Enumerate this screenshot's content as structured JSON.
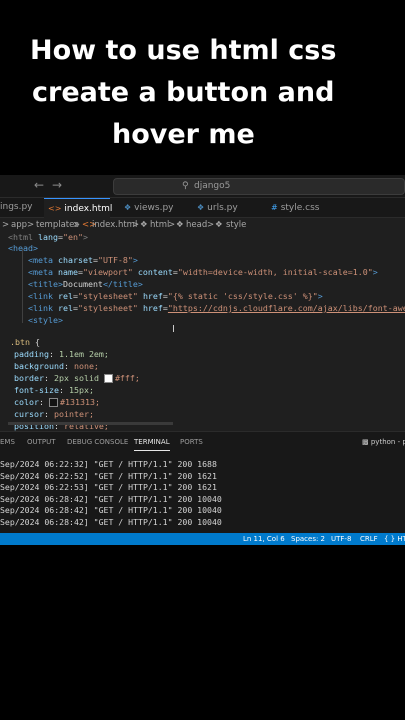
{
  "caption": {
    "line1": "How to use html css",
    "line2": "create a button and",
    "line3": "hover me"
  },
  "titlebar": {
    "back_icon": "arrow-left-icon",
    "forward_icon": "arrow-right-icon",
    "search_text": "django5",
    "search_icon": "search-icon"
  },
  "tabs": [
    {
      "label": "ings.py",
      "icon": "python-file-icon",
      "active": false
    },
    {
      "label": "index.html",
      "icon": "html-file-icon",
      "active": true
    },
    {
      "label": "views.py",
      "icon": "python-file-icon",
      "active": false
    },
    {
      "label": "urls.py",
      "icon": "python-file-icon",
      "active": false
    },
    {
      "label": "style.css",
      "icon": "css-file-icon",
      "active": false
    }
  ],
  "breadcrumb": {
    "parts": [
      "app",
      "templates",
      "index.html",
      "html",
      "head",
      "style"
    ],
    "separator": ">"
  },
  "code": {
    "l1": {
      "open": "<html ",
      "attr": "lang",
      "eq": "=",
      "val": "\"en\"",
      "close": ">"
    },
    "l2": "<head>",
    "l3": {
      "open": "<meta ",
      "attr": "charset",
      "val": "\"UTF-8\"",
      "close": ">"
    },
    "l4": {
      "open": "<meta ",
      "attr1": "name",
      "val1": "\"viewport\"",
      "attr2": "content",
      "val2": "\"width=device-width, initial-scale=1.0\"",
      "close": ">"
    },
    "l5": {
      "open": "<title>",
      "text": "Document",
      "close": "</title>"
    },
    "l6": {
      "open": "<link ",
      "attr1": "rel",
      "val1": "\"stylesheet\"",
      "attr2": "href",
      "val2": "\"{% static 'css/style.css' %}\"",
      "close": ">"
    },
    "l7": {
      "open": "<link ",
      "attr1": "rel",
      "val1": "\"stylesheet\"",
      "attr2": "href",
      "val2": "\"https://cdnjs.cloudflare.com/ajax/libs/font-awesome"
    },
    "l8": "<style>",
    "l9": {
      "selector": ".btn",
      "brace": " {"
    },
    "props": [
      {
        "name": "padding",
        "value": "1.1em 2em;"
      },
      {
        "name": "background",
        "value": "none;"
      },
      {
        "name": "border",
        "value": "2px solid ",
        "swatch": "#ffffff",
        "value2": "#fff;"
      },
      {
        "name": "font-size",
        "value": "15px;"
      },
      {
        "name": "color",
        "value": "",
        "swatch": "#131313",
        "value2": "#131313;"
      },
      {
        "name": "cursor",
        "value": "pointer;"
      },
      {
        "name": "position",
        "value": "relative;"
      }
    ]
  },
  "panel": {
    "tabs": [
      "EMS",
      "OUTPUT",
      "DEBUG CONSOLE",
      "TERMINAL",
      "PORTS"
    ],
    "active_tab": "TERMINAL",
    "terminal_name": "python - pr",
    "terminal_icon": "terminal-icon",
    "lines": [
      "Sep/2024 06:22:32] \"GET / HTTP/1.1\" 200 1688",
      "Sep/2024 06:22:52] \"GET / HTTP/1.1\" 200 1621",
      "Sep/2024 06:22:53] \"GET / HTTP/1.1\" 200 1621",
      "Sep/2024 06:28:42] \"GET / HTTP/1.1\" 200 10040",
      "Sep/2024 06:28:42] \"GET / HTTP/1.1\" 200 10040",
      "Sep/2024 06:28:42] \"GET / HTTP/1.1\" 200 10040"
    ]
  },
  "statusbar": {
    "position": "Ln 11, Col 6",
    "indent": "Spaces: 2",
    "encoding": "UTF-8",
    "eol": "CRLF",
    "language": "{ } HT"
  },
  "colors": {
    "status_bar": "#007acc",
    "active_tab_accent": "#3794ff",
    "editor_bg": "#1f1f1f"
  }
}
